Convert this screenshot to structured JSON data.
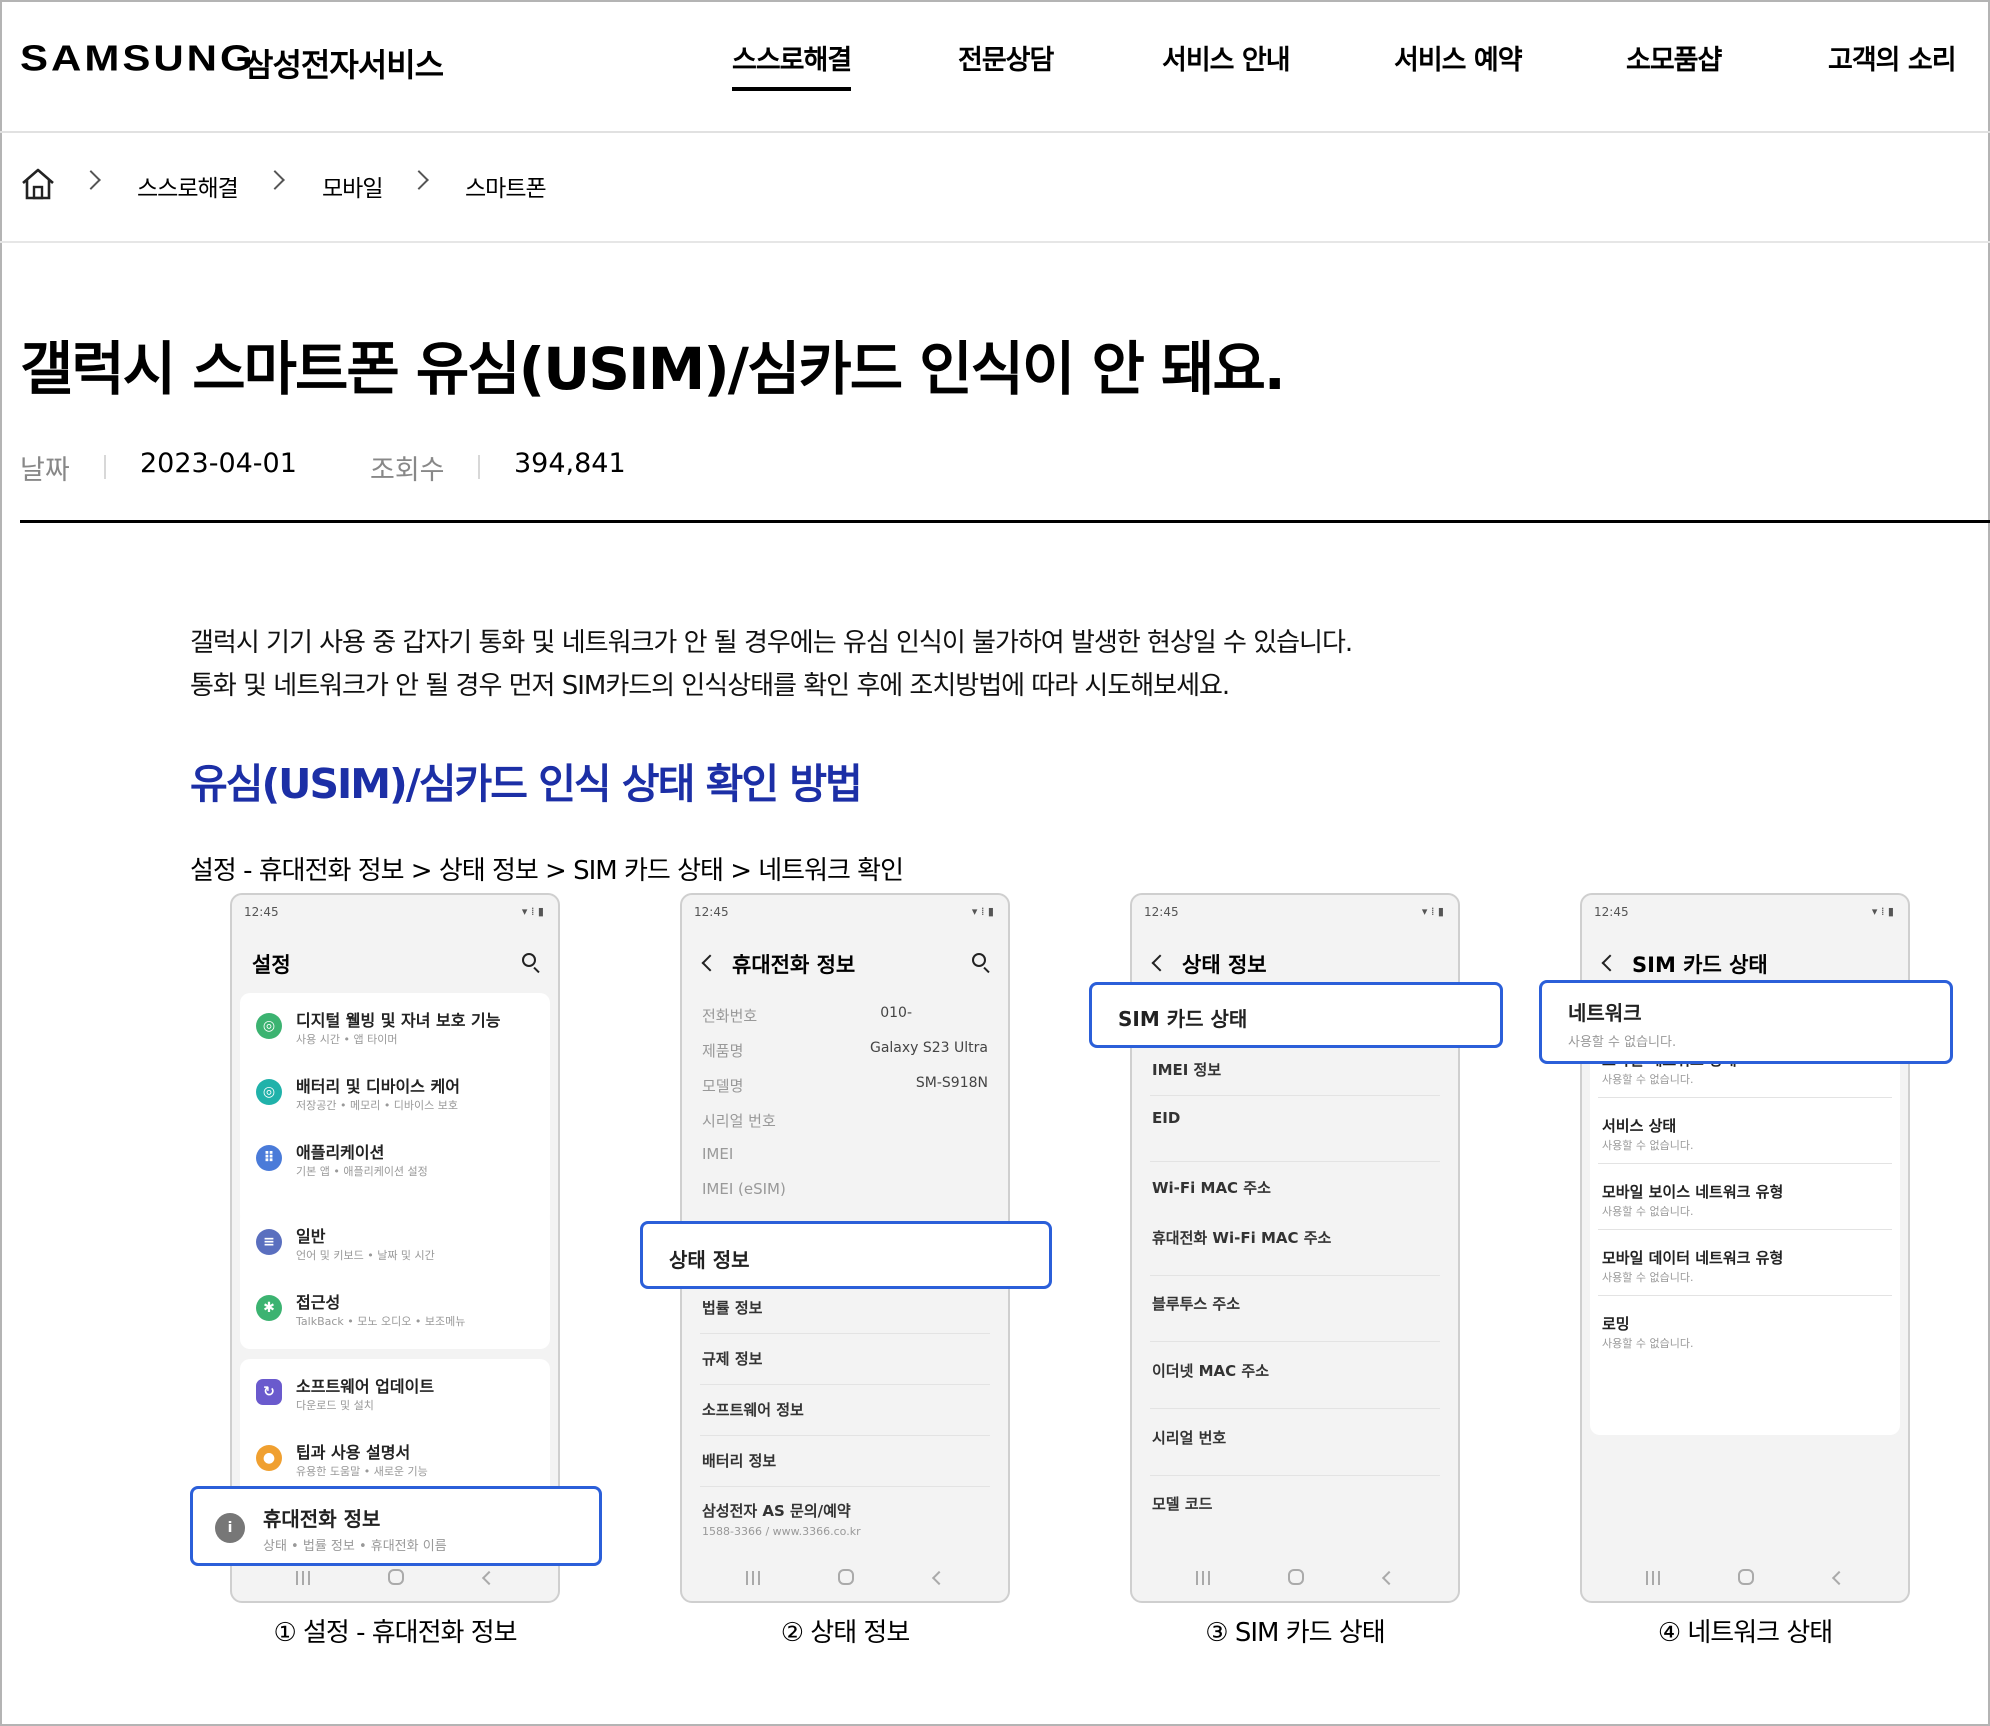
{
  "header": {
    "logo": "SAMSUNG",
    "logo_sub": "삼성전자서비스",
    "nav": [
      "스스로해결",
      "전문상담",
      "서비스 안내",
      "서비스 예약",
      "소모품샵",
      "고객의 소리"
    ]
  },
  "breadcrumb": [
    "스스로해결",
    "모바일",
    "스마트폰"
  ],
  "article": {
    "title": "갤럭시 스마트폰 유심(USIM)/심카드 인식이 안 돼요.",
    "date_label": "날짜",
    "date": "2023-04-01",
    "views_label": "조회수",
    "views": "394,841",
    "intro": [
      "갤럭시 기기 사용 중 갑자기 통화 및 네트워크가 안 될 경우에는 유심 인식이 불가하여 발생한 현상일 수 있습니다.",
      "통화 및 네트워크가 안 될 경우 먼저 SIM카드의 인식상태를 확인 후에 조치방법에 따라 시도해보세요."
    ],
    "subhead": "유심(USIM)/심카드 인식 상태 확인 방법",
    "path": "설정 - 휴대전화 정보 > 상태 정보 > SIM 카드 상태 > 네트워크 확인"
  },
  "phones": [
    {
      "time": "12:45",
      "title": "설정",
      "items": [
        {
          "main": "디지털 웰빙 및 자녀 보호 기능",
          "sub": "사용 시간 • 앱 타이머"
        },
        {
          "main": "배터리 및 디바이스 케어",
          "sub": "저장공간 • 메모리 • 디바이스 보호"
        },
        {
          "main": "애플리케이션",
          "sub": "기본 앱 • 애플리케이션 설정"
        },
        {
          "main": "일반",
          "sub": "언어 및 키보드 • 날짜 및 시간"
        },
        {
          "main": "접근성",
          "sub": "TalkBack • 모노 오디오 • 보조메뉴"
        },
        {
          "main": "소프트웨어 업데이트",
          "sub": "다운로드 및 설치"
        },
        {
          "main": "팁과 사용 설명서",
          "sub": "유용한 도움말 • 새로운 기능"
        }
      ],
      "highlight": {
        "main": "휴대전화 정보",
        "sub": "상태 • 법률 정보 • 휴대전화 이름"
      },
      "icon_colors": [
        "#3cb371",
        "#20b2aa",
        "#4a7bd9",
        "#5a6fbf",
        "#3cb371",
        "#6a5acd",
        "#f0a030",
        "#777777"
      ]
    },
    {
      "time": "12:45",
      "title": "휴대전화 정보",
      "rows": [
        {
          "label": "전화번호",
          "value": "010-"
        },
        {
          "label": "제품명",
          "value": "Galaxy S23 Ultra"
        },
        {
          "label": "모델명",
          "value": "SM-S918N"
        },
        {
          "label": "시리얼 번호",
          "value": ""
        },
        {
          "label": "IMEI",
          "value": ""
        },
        {
          "label": "IMEI (eSIM)",
          "value": ""
        }
      ],
      "highlight": {
        "main": "상태 정보"
      },
      "after": [
        "법률 정보",
        "규제 정보",
        "소프트웨어 정보",
        "배터리 정보"
      ],
      "as_main": "삼성전자 AS 문의/예약",
      "as_sub": "1588-3366 / www.3366.co.kr"
    },
    {
      "time": "12:45",
      "title": "상태 정보",
      "highlight": {
        "main": "SIM 카드 상태"
      },
      "rows": [
        "IMEI 정보",
        "EID",
        "Wi-Fi MAC 주소",
        "휴대전화 Wi-Fi MAC 주소",
        "블루투스 주소",
        "이더넷 MAC 주소",
        "시리얼 번호",
        "모델 코드"
      ]
    },
    {
      "time": "12:45",
      "title": "SIM 카드 상태",
      "highlight": {
        "main": "네트워크",
        "sub": "사용할 수 없습니다."
      },
      "items": [
        {
          "main": "모바일 네트워크 상태",
          "sub": "사용할 수 없습니다."
        },
        {
          "main": "서비스 상태",
          "sub": "사용할 수 없습니다."
        },
        {
          "main": "모바일 보이스 네트워크 유형",
          "sub": "사용할 수 없습니다."
        },
        {
          "main": "모바일 데이터 네트워크 유형",
          "sub": "사용할 수 없습니다."
        },
        {
          "main": "로밍",
          "sub": "사용할 수 없습니다."
        }
      ]
    }
  ],
  "captions": [
    "① 설정 - 휴대전화 정보",
    "② 상태 정보",
    "③ SIM 카드 상태",
    "④ 네트워크 상태"
  ],
  "colors": {
    "accent": "#1c2fa6",
    "highlight": "#2b5fd9"
  }
}
